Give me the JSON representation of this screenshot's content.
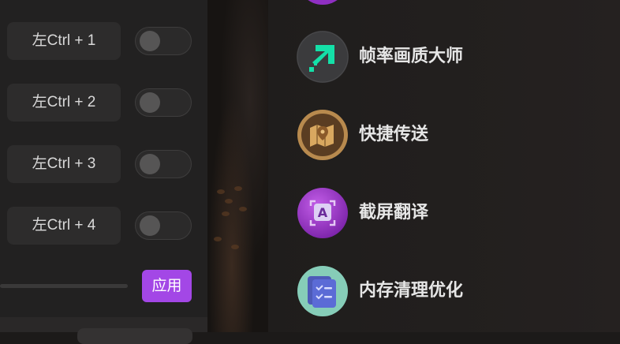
{
  "hotkeys": [
    {
      "label": "左Ctrl + 1",
      "enabled": false
    },
    {
      "label": "左Ctrl + 2",
      "enabled": false
    },
    {
      "label": "左Ctrl + 3",
      "enabled": false
    },
    {
      "label": "左Ctrl + 4",
      "enabled": false
    }
  ],
  "apply_label": "应用",
  "tools": [
    {
      "label": "帧率画质大师",
      "icon": "fps-quality-icon"
    },
    {
      "label": "快捷传送",
      "icon": "map-teleport-icon"
    },
    {
      "label": "截屏翻译",
      "icon": "screenshot-translate-icon"
    },
    {
      "label": "内存清理优化",
      "icon": "memory-clean-icon"
    }
  ],
  "colors": {
    "accent": "#a347e6",
    "panel": "#222121",
    "text": "#e6e6e6"
  }
}
